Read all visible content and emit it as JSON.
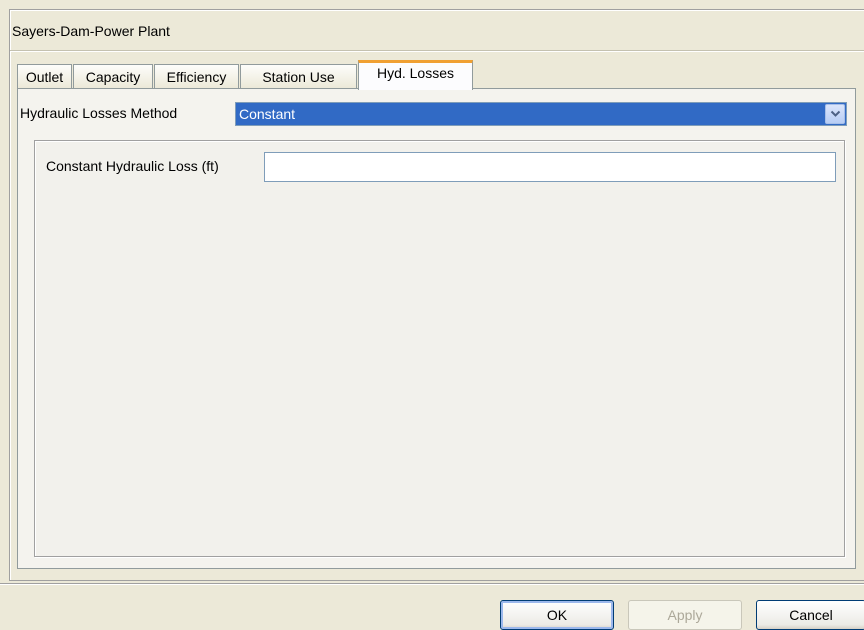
{
  "window": {
    "title": "Sayers-Dam-Power Plant"
  },
  "tabs": [
    {
      "label": "Outlet",
      "active": false
    },
    {
      "label": "Capacity",
      "active": false
    },
    {
      "label": "Efficiency",
      "active": false
    },
    {
      "label": "Station Use",
      "active": false
    },
    {
      "label": "Hyd. Losses",
      "active": true
    }
  ],
  "hyd_losses": {
    "method_label": "Hydraulic Losses Method",
    "method_value": "Constant",
    "constant_loss_label": "Constant Hydraulic Loss (ft)",
    "constant_loss_value": ""
  },
  "buttons": {
    "ok": "OK",
    "apply": "Apply",
    "cancel": "Cancel"
  },
  "colors": {
    "selection": "#316ac5",
    "active_tab_accent": "#f0a032",
    "dialog_bg": "#ece9d8"
  },
  "icons": {
    "dropdown": "chevron-down-icon"
  }
}
